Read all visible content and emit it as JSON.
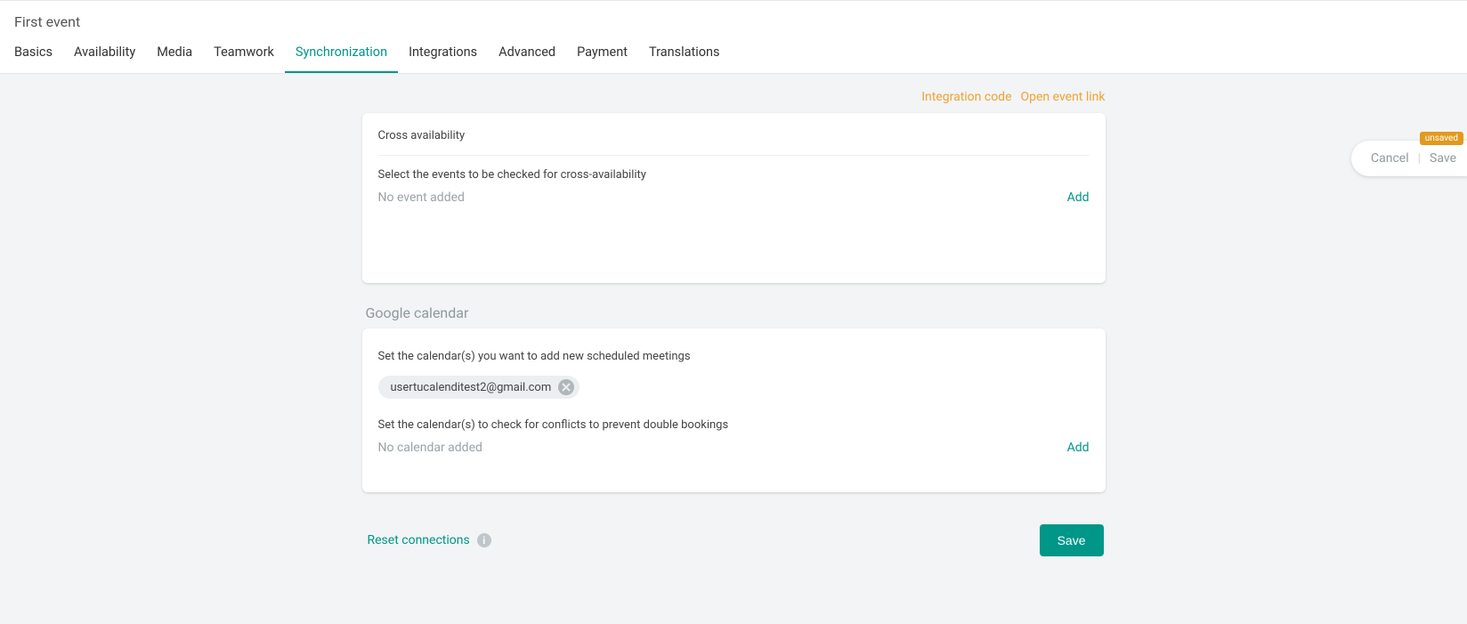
{
  "header": {
    "event_title": "First event",
    "tabs": [
      {
        "label": "Basics",
        "active": false
      },
      {
        "label": "Availability",
        "active": false
      },
      {
        "label": "Media",
        "active": false
      },
      {
        "label": "Teamwork",
        "active": false
      },
      {
        "label": "Synchronization",
        "active": true
      },
      {
        "label": "Integrations",
        "active": false
      },
      {
        "label": "Advanced",
        "active": false
      },
      {
        "label": "Payment",
        "active": false
      },
      {
        "label": "Translations",
        "active": false
      }
    ]
  },
  "top_links": {
    "integration_code": "Integration code",
    "open_event_link": "Open event link"
  },
  "cross_availability": {
    "title": "Cross availability",
    "subtitle": "Select the events to be checked for cross-availability",
    "empty": "No event added",
    "add": "Add"
  },
  "google_calendar_section": {
    "label": "Google calendar",
    "line1": "Set the calendar(s) you want to add new scheduled meetings",
    "chip_email": "usertucalenditest2@gmail.com",
    "line2": "Set the calendar(s) to check for conflicts to prevent double bookings",
    "empty": "No calendar added",
    "add": "Add"
  },
  "footer": {
    "reset": "Reset connections",
    "info_glyph": "i",
    "save": "Save"
  },
  "float": {
    "badge": "unsaved",
    "cancel": "Cancel",
    "divider": "|",
    "save": "Save"
  }
}
